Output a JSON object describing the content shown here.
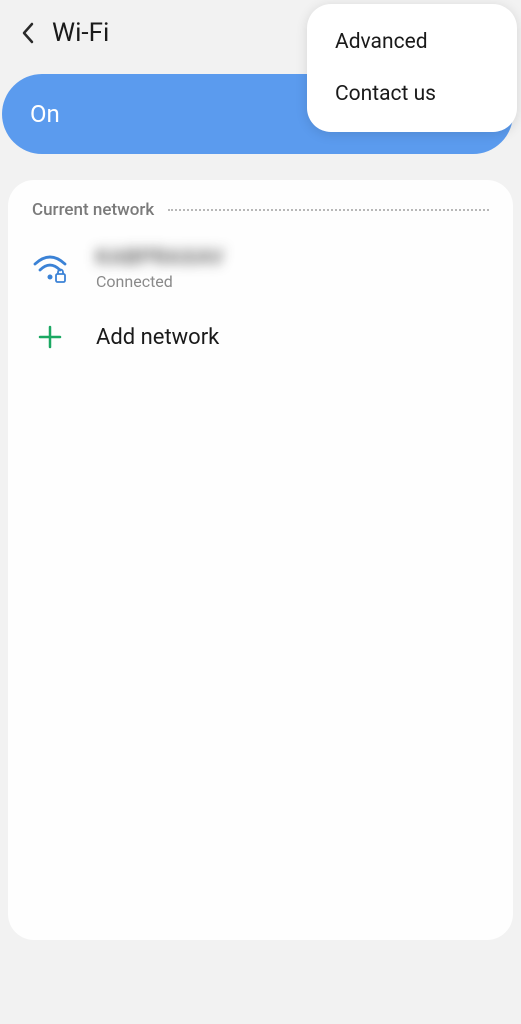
{
  "header": {
    "title": "Wi-Fi"
  },
  "toggle": {
    "label": "On"
  },
  "section": {
    "title": "Current network"
  },
  "network": {
    "name": "KABPRAXAV",
    "status": "Connected"
  },
  "add": {
    "label": "Add network"
  },
  "menu": {
    "item1": "Advanced",
    "item2": "Contact us"
  }
}
